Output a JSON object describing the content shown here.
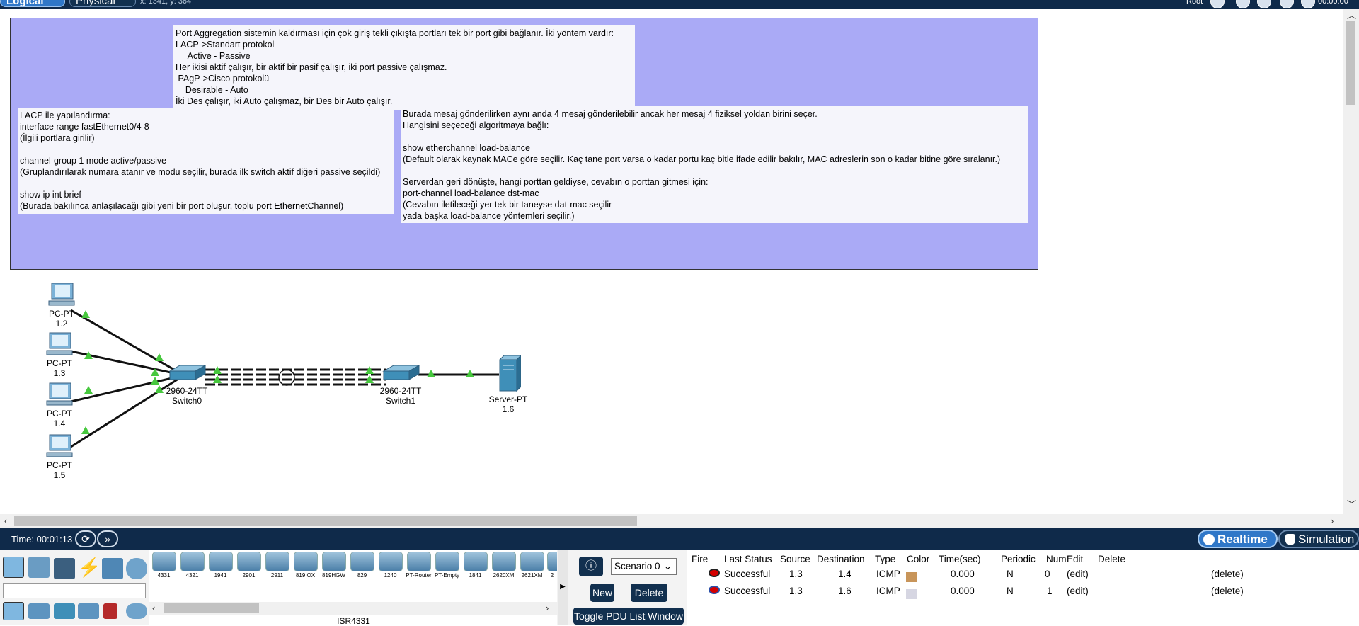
{
  "topbar": {
    "logical_tab": "Logical",
    "physical_tab": "Physical",
    "coords": "x: 1341, y: 364",
    "root_label": "Root",
    "clock": "00:00:00"
  },
  "notes": {
    "port_aggregation": "Port Aggregation sistemin kaldırması için çok giriş tekli çıkışta portları tek bir port gibi bağlanır. İki yöntem vardır:\nLACP->Standart protokol\n     Active - Passive\nHer ikisi aktif çalışır, bir aktif bir pasif çalışır, iki port passive çalışmaz.\n PAgP->Cisco protokolü\n    Desirable - Auto\nİki Des çalışır, iki Auto çalışmaz, bir Des bir Auto çalışır.",
    "lacp_config": "LACP ile yapılandırma:\ninterface range fastEthernet0/4-8\n(İlgili portlara girilir)\n\nchannel-group 1 mode active/passive\n(Gruplandırılarak numara atanır ve modu seçilir, burada ilk switch aktif diğeri passive seçildi)\n\nshow ip int brief\n(Burada bakılınca anlaşılacağı gibi yeni bir port oluşur, toplu port EthernetChannel)",
    "load_balance": "Burada mesaj gönderilirken aynı anda 4 mesaj gönderilebilir ancak her mesaj 4 fiziksel yoldan birini seçer.\nHangisini seçeceği algoritmaya bağlı:\n\nshow etherchannel load-balance\n(Default olarak kaynak MACe göre seçilir. Kaç tane port varsa o kadar portu kaç bitle ifade edilir bakılır, MAC adreslerin son o kadar bitine göre sıralanır.)\n\nServerdan geri dönüşte, hangi porttan geldiyse, cevabın o porttan gitmesi için:\nport-channel load-balance dst-mac\n(Cevabın iletileceği yer tek bir taneyse dat-mac seçilir\nyada başka load-balance yöntemleri seçilir.)"
  },
  "devices": [
    {
      "type": "PC-PT",
      "label": "1.2"
    },
    {
      "type": "PC-PT",
      "label": "1.3"
    },
    {
      "type": "PC-PT",
      "label": "1.4"
    },
    {
      "type": "PC-PT",
      "label": "1.5"
    },
    {
      "type": "2960-24TT",
      "label": "Switch0"
    },
    {
      "type": "2960-24TT",
      "label": "Switch1"
    },
    {
      "type": "Server-PT",
      "label": "1.6"
    }
  ],
  "timebar": {
    "time": "Time: 00:01:13",
    "realtime": "Realtime",
    "simulation": "Simulation"
  },
  "device_models": [
    "4331",
    "4321",
    "1941",
    "2901",
    "2911",
    "819IOX",
    "819HGW",
    "829",
    "1240",
    "PT-Router",
    "PT-Empty",
    "1841",
    "2620XM",
    "2621XM",
    "2"
  ],
  "device_model_caption": "ISR4331",
  "scenario": {
    "selected": "Scenario 0",
    "new_label": "New",
    "delete_label": "Delete",
    "toggle_label": "Toggle PDU List Window"
  },
  "pdu_table": {
    "headers": [
      "Fire",
      "Last Status",
      "Source",
      "Destination",
      "Type",
      "Color",
      "Time(sec)",
      "Periodic",
      "Num",
      "Edit",
      "Delete"
    ],
    "rows": [
      {
        "status": "Successful",
        "source": "1.3",
        "destination": "1.4",
        "type": "ICMP",
        "color": "#c8955a",
        "time": "0.000",
        "periodic": "N",
        "num": "0",
        "edit": "(edit)",
        "delete": "(delete)"
      },
      {
        "status": "Successful",
        "source": "1.3",
        "destination": "1.6",
        "type": "ICMP",
        "color": "#d6d6e2",
        "time": "0.000",
        "periodic": "N",
        "num": "1",
        "edit": "(edit)",
        "delete": "(delete)"
      }
    ]
  }
}
